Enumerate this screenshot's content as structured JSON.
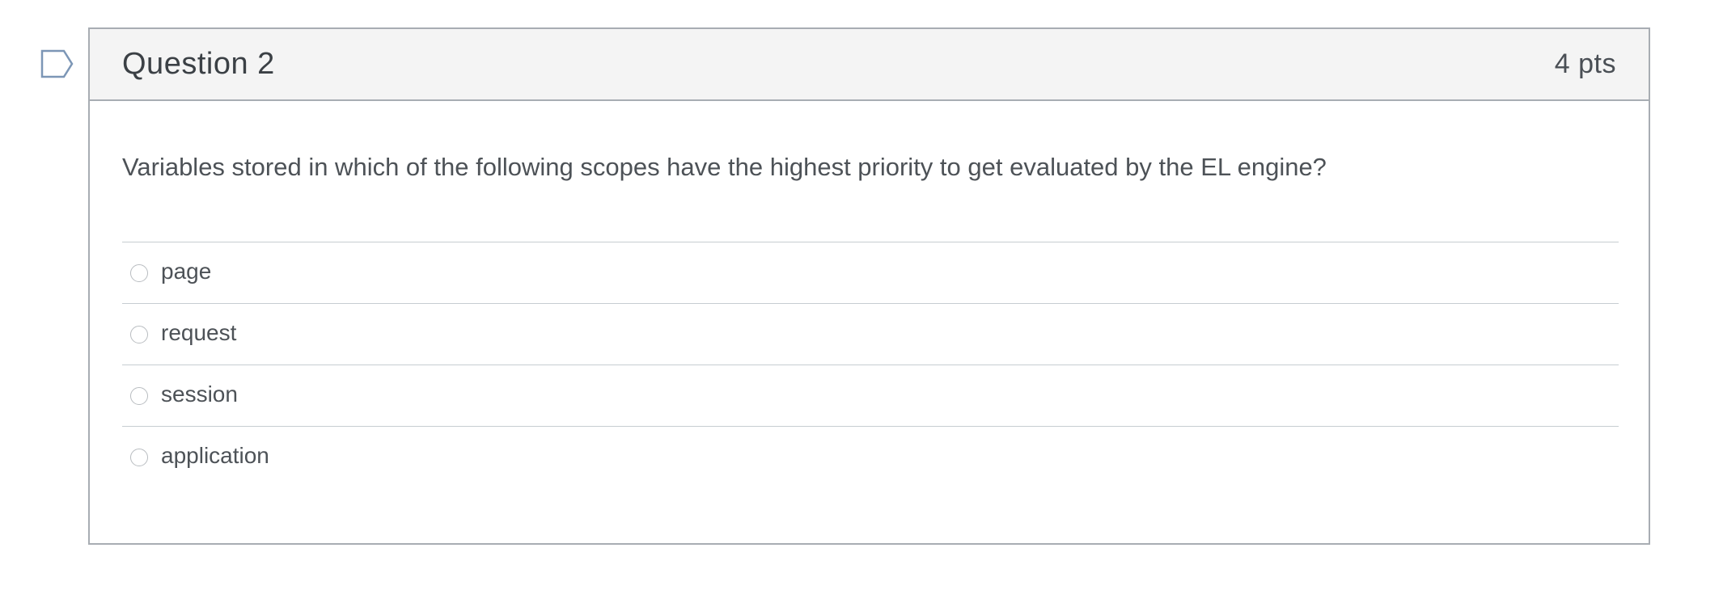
{
  "question": {
    "title": "Question 2",
    "points": "4 pts",
    "flag_icon": "flag-bookmark-icon",
    "text": "Variables stored in which of the following scopes have the highest priority to get evaluated by the EL engine?",
    "answers": [
      {
        "label": "page"
      },
      {
        "label": "request"
      },
      {
        "label": "session"
      },
      {
        "label": "application"
      }
    ],
    "selected_answer": null
  },
  "colors": {
    "header_bg": "#f4f4f4",
    "border": "#a8adb3",
    "flag_outline": "#7c96b6",
    "text": "#4d5257"
  }
}
